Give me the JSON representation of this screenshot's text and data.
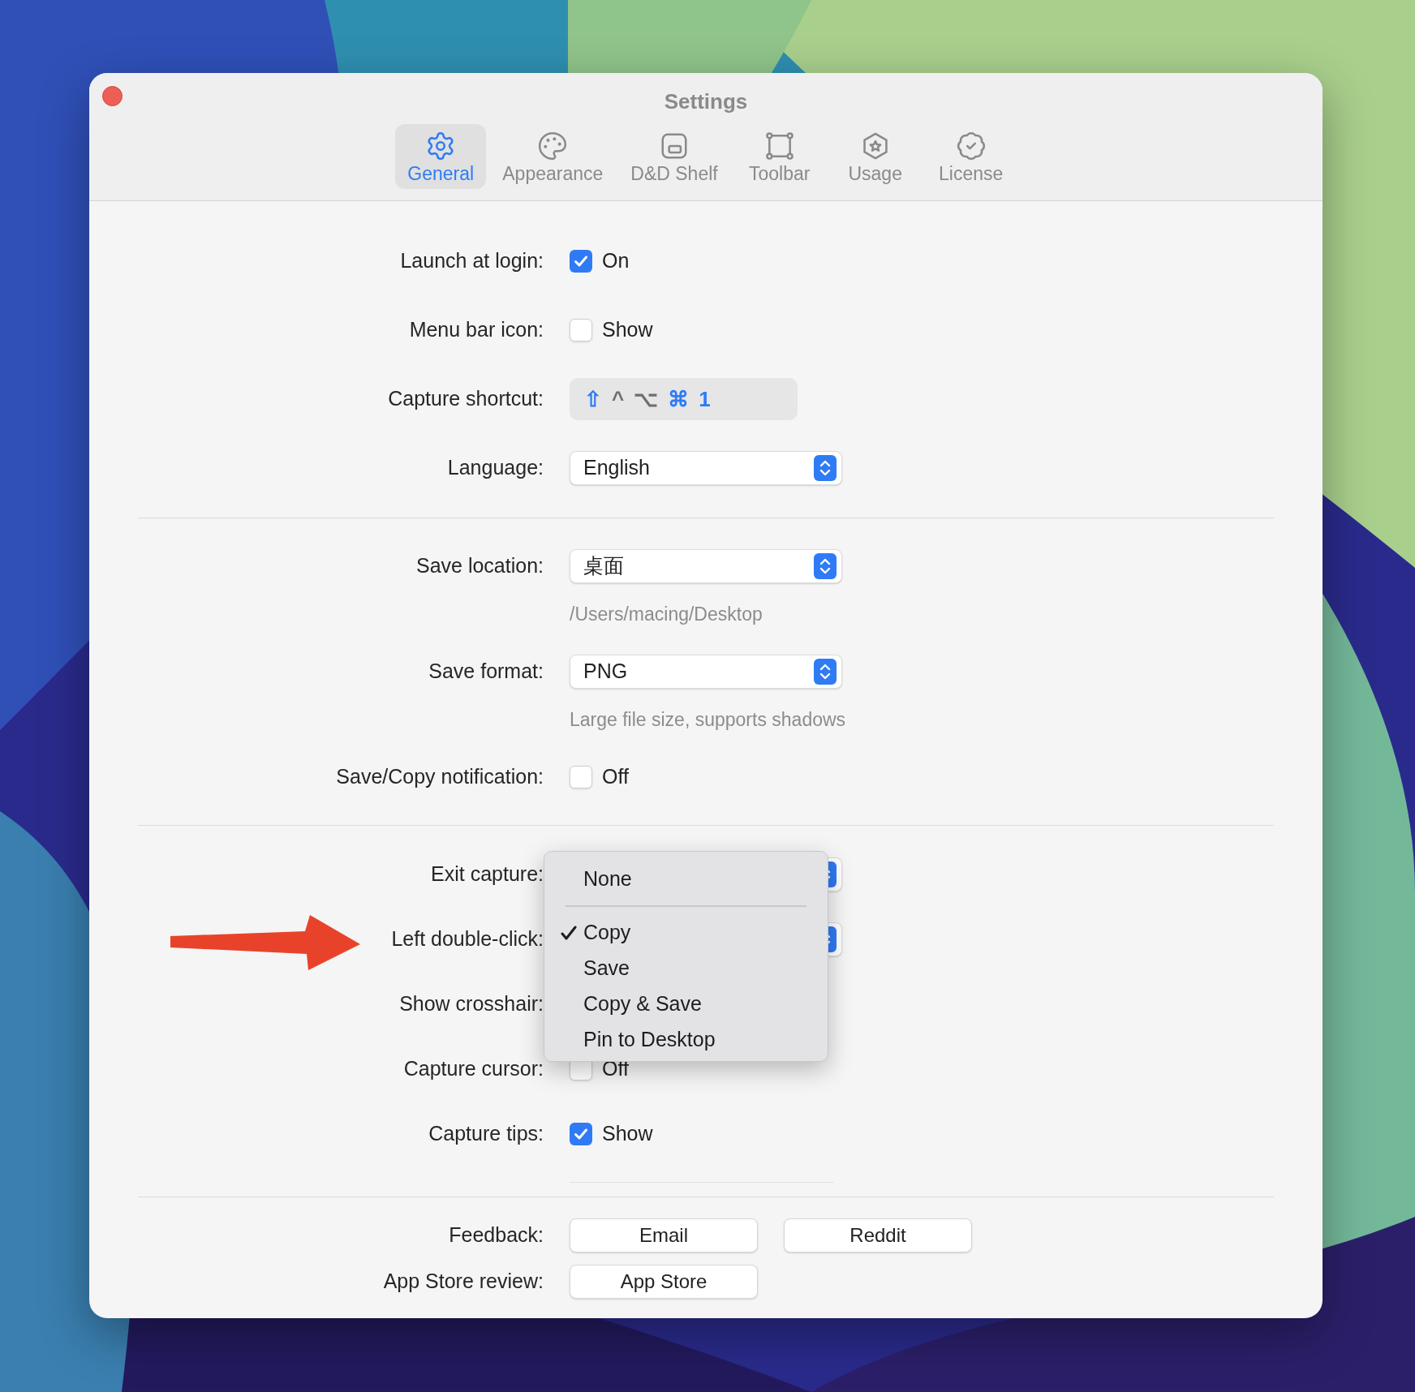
{
  "window": {
    "title": "Settings"
  },
  "tabs": [
    {
      "label": "General",
      "kind": "gear",
      "selected": true
    },
    {
      "label": "Appearance",
      "kind": "palette",
      "selected": false
    },
    {
      "label": "D&D Shelf",
      "kind": "shelf",
      "selected": false
    },
    {
      "label": "Toolbar",
      "kind": "frame",
      "selected": false
    },
    {
      "label": "Usage",
      "kind": "star",
      "selected": false
    },
    {
      "label": "License",
      "kind": "badge",
      "selected": false
    }
  ],
  "sections": [
    {
      "rows": [
        {
          "label": "Launch at login:",
          "kind": "checkbox",
          "option": "On",
          "checked": true
        },
        {
          "label": "Menu bar icon:",
          "kind": "checkbox",
          "option": "Show",
          "checked": false
        },
        {
          "label": "Capture shortcut:",
          "kind": "shortcut",
          "keys": [
            {
              "symbol": "⇧",
              "on": true
            },
            {
              "symbol": "^",
              "on": false
            },
            {
              "symbol": "⌥",
              "on": false
            },
            {
              "symbol": "⌘",
              "on": true
            },
            {
              "symbol": "1",
              "on": true
            }
          ]
        },
        {
          "label": "Language:",
          "kind": "select",
          "value": "English"
        }
      ]
    },
    {
      "rows": [
        {
          "label": "Save location:",
          "kind": "select",
          "value": "桌面",
          "hint": "/Users/macing/Desktop"
        },
        {
          "label": "Save format:",
          "kind": "select",
          "value": "PNG",
          "hint": "Large file size, supports shadows"
        },
        {
          "label": "Save/Copy notification:",
          "kind": "checkbox",
          "option": "Off",
          "checked": false
        }
      ]
    },
    {
      "rows": [
        {
          "label": "Exit capture:",
          "kind": "covered_select"
        },
        {
          "label": "Left double-click:",
          "kind": "covered_select"
        },
        {
          "label": "Show crosshair:",
          "kind": "covered"
        },
        {
          "label": "Capture cursor:",
          "kind": "checkbox",
          "option": "Off",
          "checked": false
        },
        {
          "label": "Capture tips:",
          "kind": "checkbox",
          "option": "Show",
          "checked": true
        }
      ]
    },
    {
      "rows": [
        {
          "label": "Feedback:",
          "kind": "buttons",
          "buttons": [
            "Email",
            "Reddit"
          ]
        },
        {
          "label": "App Store review:",
          "kind": "buttons",
          "buttons": [
            "App Store"
          ]
        }
      ]
    }
  ],
  "menu": {
    "items": [
      {
        "kind": "option",
        "label": "None",
        "selected": false
      },
      {
        "kind": "separator"
      },
      {
        "kind": "option",
        "label": "Copy",
        "selected": true
      },
      {
        "kind": "option",
        "label": "Save",
        "selected": false
      },
      {
        "kind": "option",
        "label": "Copy & Save",
        "selected": false
      },
      {
        "kind": "option",
        "label": "Pin to Desktop",
        "selected": false
      }
    ]
  }
}
